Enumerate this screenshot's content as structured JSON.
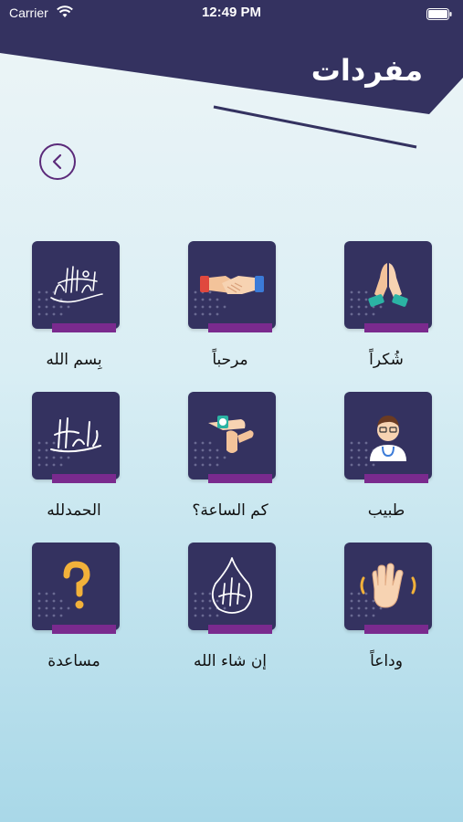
{
  "status_bar": {
    "carrier": "Carrier",
    "time": "12:49 PM"
  },
  "header": {
    "title": "مفردات"
  },
  "colors": {
    "header": "#343260",
    "accent": "#7a2a8e",
    "back_ring": "#5b2a7a"
  },
  "tiles": [
    {
      "label": "بِسم الله",
      "icon": "bismillah-calligraphy-icon"
    },
    {
      "label": "مرحباً",
      "icon": "handshake-icon"
    },
    {
      "label": "شُكراً",
      "icon": "praying-hands-icon"
    },
    {
      "label": "الحمدلله",
      "icon": "alhamdulillah-calligraphy-icon"
    },
    {
      "label": "كم الساعة؟",
      "icon": "wristwatch-icon"
    },
    {
      "label": "طبيب",
      "icon": "doctor-icon"
    },
    {
      "label": "مساعدة",
      "icon": "question-mark-icon"
    },
    {
      "label": "إن شاء الله",
      "icon": "inshallah-calligraphy-icon"
    },
    {
      "label": "وداعاً",
      "icon": "waving-hand-icon"
    }
  ]
}
